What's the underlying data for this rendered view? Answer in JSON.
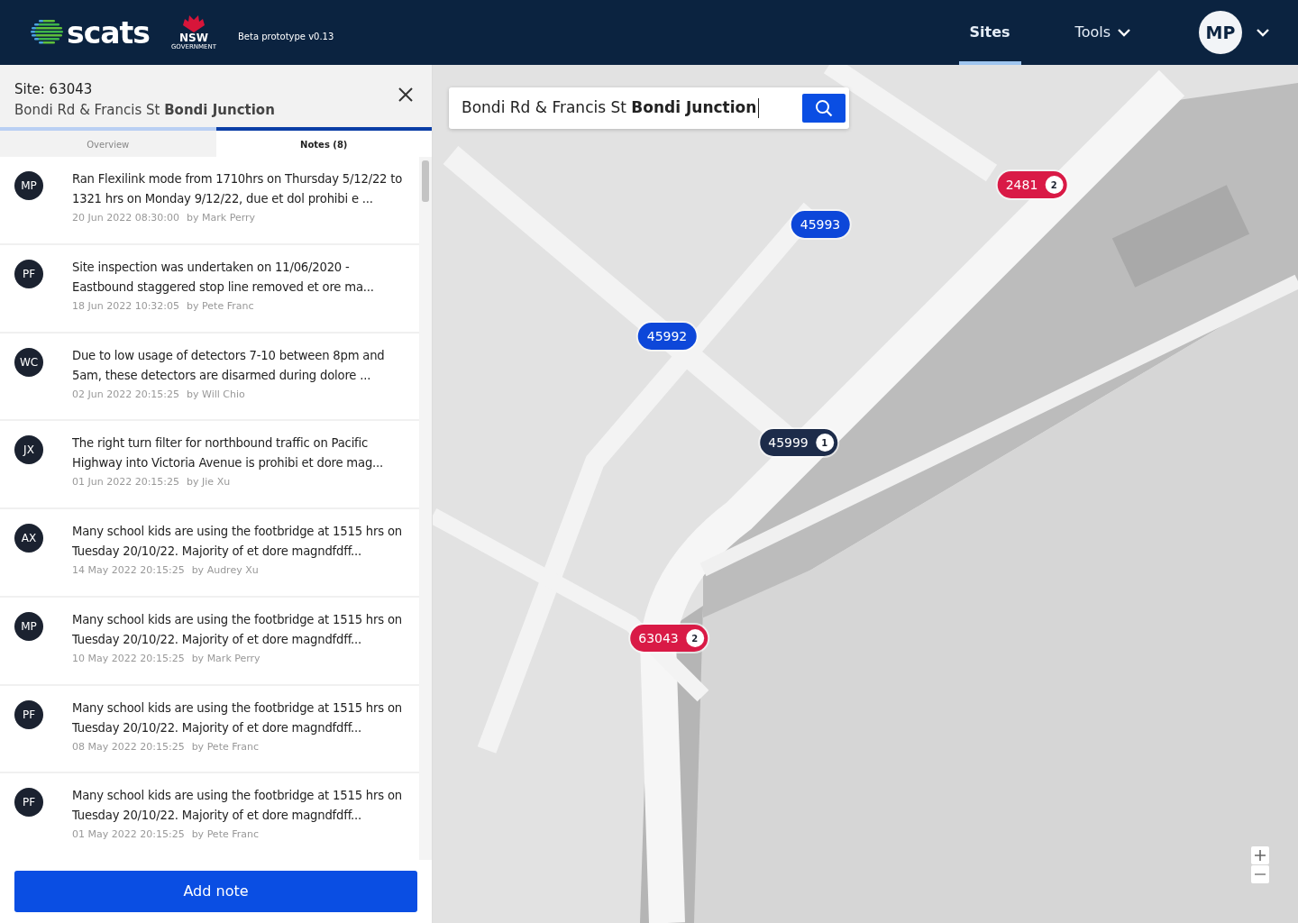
{
  "header": {
    "brand": "scats",
    "gov_logo": {
      "name": "NSW",
      "sub": "GOVERNMENT"
    },
    "version": "Beta prototype v0.13",
    "nav": [
      {
        "label": "Sites",
        "selected": true,
        "kind": "link"
      },
      {
        "label": "Tools",
        "selected": false,
        "kind": "dropdown"
      }
    ],
    "user": {
      "initials": "MP"
    }
  },
  "panel": {
    "site_label": "Site: 63043",
    "site_address": "Bondi Rd & Francis St **Bondi Junction**",
    "tabs": [
      {
        "label": "Overview",
        "selected": false
      },
      {
        "label": "Notes (8)",
        "selected": true
      }
    ],
    "notes": [
      {
        "initials": "MP",
        "text": "Ran Flexilink mode from 1710hrs on Thursday 5/12/22 to 1321 hrs on Monday 9/12/22, due et dol prohibi e ...",
        "date": "20 Jun 2022 08:30:00",
        "author": "by Mark Perry"
      },
      {
        "initials": "PF",
        "text": "Site inspection was undertaken on 11/06/2020 - Eastbound staggered stop line removed et ore ma...",
        "date": "18 Jun 2022 10:32:05",
        "author": "by Pete Franc"
      },
      {
        "initials": "WC",
        "text": "Due to low usage of detectors 7-10 between 8pm and 5am, these detectors are disarmed during  dolore ...",
        "date": "02 Jun 2022 20:15:25",
        "author": "by Will Chio"
      },
      {
        "initials": "JX",
        "text": "The right turn filter for northbound traffic on Pacific Highway into Victoria Avenue is prohibi et dore mag...",
        "date": "01 Jun 2022 20:15:25",
        "author": "by Jie Xu"
      },
      {
        "initials": "AX",
        "text": "Many school kids are using the footbridge at 1515 hrs on Tuesday 20/10/22. Majority of et dore magndfdff...",
        "date": "14 May 2022 20:15:25",
        "author": "by Audrey Xu"
      },
      {
        "initials": "MP",
        "text": "Many school kids are using the footbridge at 1515 hrs on Tuesday 20/10/22. Majority of et dore magndfdff...",
        "date": "10 May 2022 20:15:25",
        "author": "by Mark Perry"
      },
      {
        "initials": "PF",
        "text": "Many school kids are using the footbridge at 1515 hrs on Tuesday 20/10/22. Majority of et dore magndfdff...",
        "date": "08 May 2022 20:15:25",
        "author": "by Pete Franc"
      },
      {
        "initials": "PF",
        "text": "Many school kids are using the footbridge at 1515 hrs on Tuesday 20/10/22. Majority of et dore magndfdff...",
        "date": "01 May 2022 20:15:25",
        "author": "by Pete Franc"
      }
    ],
    "add_button": "Add note"
  },
  "map": {
    "kind": "picture",
    "search": {
      "value": "Bondi Rd & Francis St **Bondi Junction**"
    },
    "markers": [
      {
        "label": "2481",
        "count": "2",
        "color": "#d91a46"
      },
      {
        "label": "45993",
        "color": "#0d47d9"
      },
      {
        "label": "45992",
        "color": "#0d47d9"
      },
      {
        "label": "45999",
        "count": "1",
        "color": "#1d2c4a"
      },
      {
        "label": "63043",
        "count": "2",
        "color": "#d91a46"
      }
    ]
  }
}
